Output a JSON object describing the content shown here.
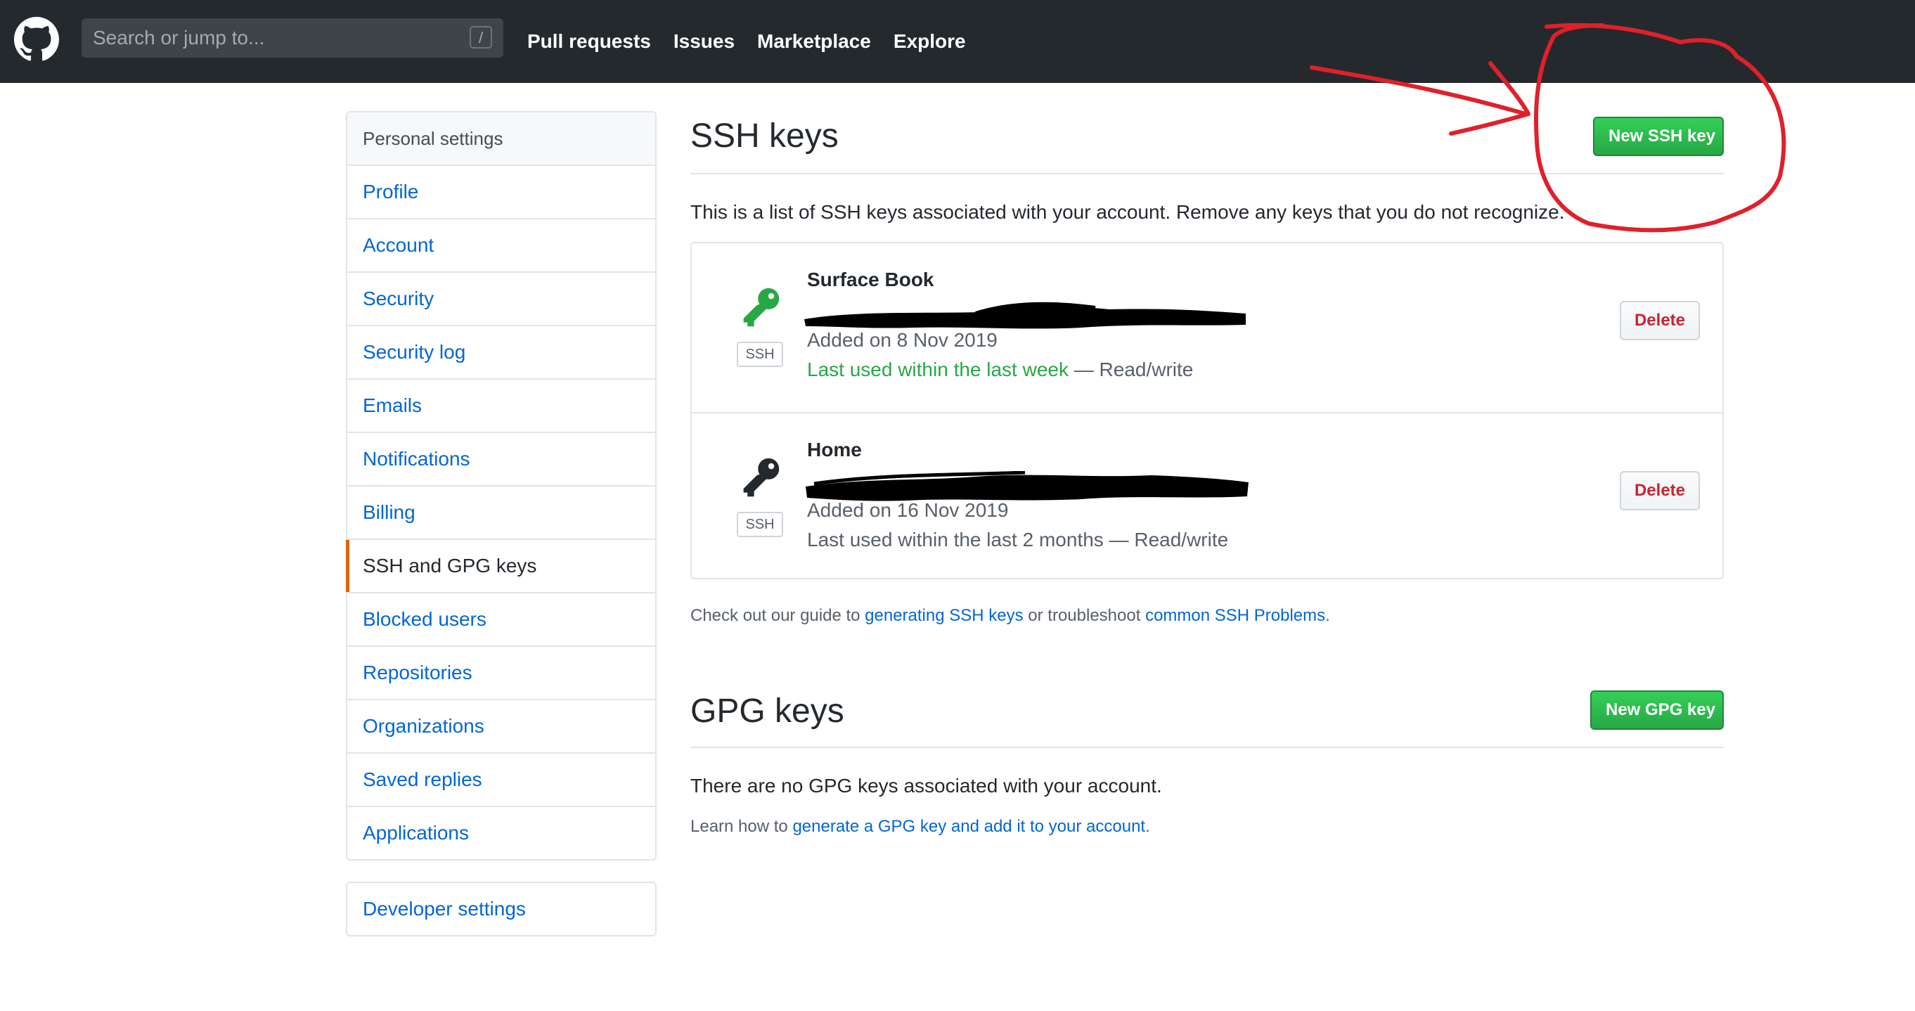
{
  "header": {
    "search_placeholder": "Search or jump to...",
    "search_shortcut": "/",
    "nav": {
      "pulls": "Pull requests",
      "issues": "Issues",
      "marketplace": "Marketplace",
      "explore": "Explore"
    }
  },
  "sidebar": {
    "heading": "Personal settings",
    "items": [
      {
        "label": "Profile"
      },
      {
        "label": "Account"
      },
      {
        "label": "Security"
      },
      {
        "label": "Security log"
      },
      {
        "label": "Emails"
      },
      {
        "label": "Notifications"
      },
      {
        "label": "Billing"
      },
      {
        "label": "SSH and GPG keys",
        "selected": true
      },
      {
        "label": "Blocked users"
      },
      {
        "label": "Repositories"
      },
      {
        "label": "Organizations"
      },
      {
        "label": "Saved replies"
      },
      {
        "label": "Applications"
      }
    ],
    "developer_settings": "Developer settings"
  },
  "ssh": {
    "title": "SSH keys",
    "new_button": "New SSH key",
    "intro": "This is a list of SSH keys associated with your account. Remove any keys that you do not recognize.",
    "keys": [
      {
        "title": "Surface Book",
        "type_label": "SSH",
        "added": "Added on 8 Nov 2019",
        "last_used": "Last used within the last week",
        "access": " — Read/write",
        "delete_label": "Delete",
        "icon_color": "#28a745"
      },
      {
        "title": "Home",
        "type_label": "SSH",
        "added": "Added on 16 Nov 2019",
        "last_used": "Last used within the last 2 months",
        "access": " — Read/write",
        "delete_label": "Delete",
        "icon_color": "#24292e"
      }
    ],
    "guide": {
      "prefix": "Check out our guide to ",
      "link1": "generating SSH keys",
      "middle": " or troubleshoot ",
      "link2": "common SSH Problems",
      "suffix": "."
    }
  },
  "gpg": {
    "title": "GPG keys",
    "new_button": "New GPG key",
    "empty": "There are no GPG keys associated with your account.",
    "learn": {
      "prefix": "Learn how to ",
      "link": "generate a GPG key and add it to your account",
      "suffix": "."
    }
  },
  "colors": {
    "header_bg": "#24292e",
    "link": "#0366d6",
    "primary_green": "#28a745",
    "danger": "#cb2431",
    "annotation_red": "#e0202a"
  }
}
